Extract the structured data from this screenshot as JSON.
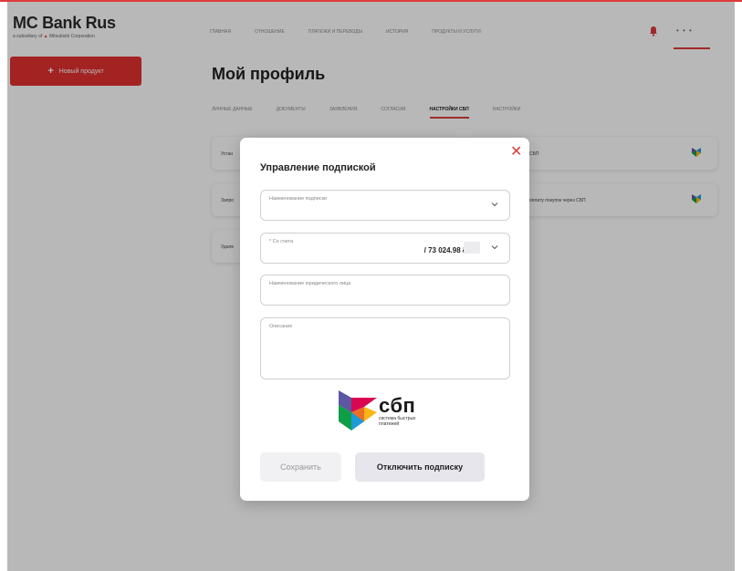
{
  "header": {
    "logo_title": "MC Bank Rus",
    "logo_subtitle_prefix": "a subsidiary of",
    "logo_subtitle_brand": "Mitsubishi Corporation",
    "nav": [
      "Главная",
      "Отношение",
      "Платежи и переводы",
      "История",
      "Продукты и услуги"
    ],
    "more_label": "• • •"
  },
  "sidebar": {
    "new_product_label": "Новый продукт"
  },
  "main": {
    "page_title": "Мой профиль",
    "tabs": [
      "Личные данные",
      "Документы",
      "Заявления",
      "Согласия",
      "Настройки СБП",
      "Настройки"
    ],
    "active_tab": "Настройки СБП",
    "cards": [
      {
        "left_text": "Устан",
        "right_text": "СБП"
      },
      {
        "left_text": "Запро",
        "right_text": "оплату покупок через СБП"
      },
      {
        "left_text": "Удале",
        "right_text": ""
      }
    ]
  },
  "modal": {
    "title": "Управление подпиской",
    "close_icon": "close-icon",
    "fields": {
      "subscription_name_label": "Наименование подписки",
      "from_account_label": "* Со счета",
      "from_account_amount": "/ 73 024.98 ₽",
      "legal_entity_label": "Наименование юридического лица",
      "description_label": "Описание"
    },
    "sbp": {
      "word": "сбп",
      "subtitle": "система быстрых платежей"
    },
    "save_label": "Сохранить",
    "disable_label": "Отключить подписку"
  },
  "colors": {
    "accent": "#e03a3a",
    "primary_button": "#e23131"
  }
}
